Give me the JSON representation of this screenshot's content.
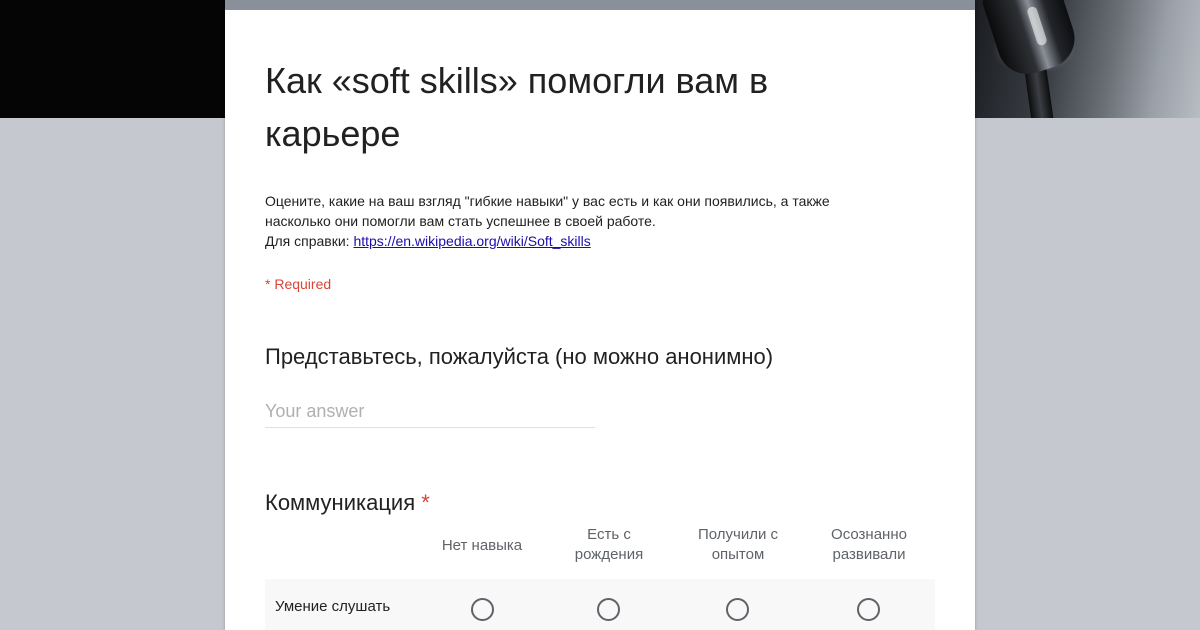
{
  "form": {
    "title": "Как «soft skills» помогли вам в карьере",
    "description_line1": "Оцените, какие на ваш взгляд \"гибкие навыки\" у вас есть и как они появились, а также",
    "description_line2": "насколько они помогли вам стать успешнее в своей работе.",
    "reference_label": "Для справки: ",
    "reference_link": "https://en.wikipedia.org/wiki/Soft_skills",
    "required_note": "* Required"
  },
  "questions": [
    {
      "title": "Представьтесь, пожалуйста (но можно анонимно)",
      "answer_placeholder": "Your answer",
      "answer_value": ""
    },
    {
      "title": "Коммуникация",
      "required_mark": "*",
      "columns": [
        {
          "line1": "Нет навыка",
          "line2": ""
        },
        {
          "line1": "Есть с",
          "line2": "рождения"
        },
        {
          "line1": "Получили с",
          "line2": "опытом"
        },
        {
          "line1": "Осознанно",
          "line2": "развивали"
        }
      ],
      "rows": [
        {
          "label": "Умение слушать",
          "selected": null
        }
      ]
    }
  ],
  "colors": {
    "header_band": "#050505",
    "page_background": "#c5c9cf",
    "card_top_border": "#8a9099",
    "required_red": "#db4437",
    "link_blue": "#1a0dab"
  }
}
